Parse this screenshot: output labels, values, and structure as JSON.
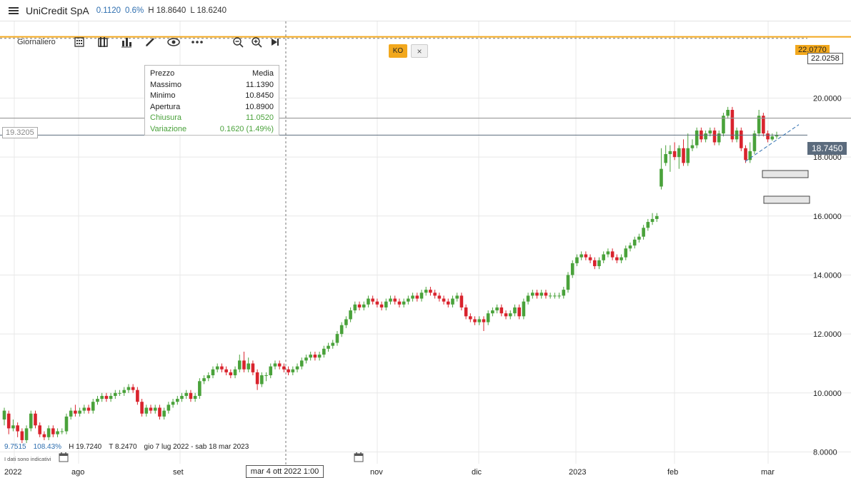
{
  "header": {
    "title": "UniCredit SpA",
    "change_abs": "0.1120",
    "change_pct": "0.6%",
    "high": "H 18.8640",
    "low": "L 18.6240"
  },
  "toolbar": {
    "period": "Giornaliero",
    "icons": [
      "calendar-grid-icon",
      "bar-style-icon",
      "indicators-icon",
      "pencil-icon",
      "eye-icon",
      "more-icon",
      "zoom-out-icon",
      "zoom-in-icon",
      "play-forward-icon"
    ]
  },
  "tooltip": {
    "head_label": "Prezzo",
    "head_value": "Media",
    "rows": [
      {
        "label": "Massimo",
        "value": "11.1390"
      },
      {
        "label": "Minimo",
        "value": "10.8450"
      },
      {
        "label": "Apertura",
        "value": "10.8900"
      },
      {
        "label": "Chiusura",
        "value": "11.0520"
      },
      {
        "label": "Variazione",
        "value": "0.1620 (1.49%)"
      }
    ]
  },
  "ko": {
    "label": "KO",
    "close": "×",
    "price": "22.0770",
    "color": "#f2a81d"
  },
  "crosshair": {
    "price": "22.0258",
    "date": "mar 4 ott 2022 1:00"
  },
  "hline": {
    "price": "19.3205"
  },
  "last_price": {
    "value": "18.7450",
    "color": "#5b6b7d"
  },
  "footer": {
    "first": "9.7515",
    "pct": "108.43%",
    "high": "H 19.7240",
    "low": "T 8.2470",
    "range": "gio 7 lug 2022 - sab 18 mar 2023",
    "disclaimer": "I dati sono indicativi"
  },
  "chart_data": {
    "type": "candlestick",
    "title": "UniCredit SpA",
    "y_ticks": [
      "8.0000",
      "10.0000",
      "12.0000",
      "14.0000",
      "16.0000",
      "18.0000",
      "20.0000"
    ],
    "x_ticks": [
      "2022",
      "ago",
      "set",
      "ott",
      "nov",
      "dic",
      "2023",
      "feb",
      "mar"
    ],
    "ylim": [
      7.6,
      22.6
    ],
    "up_color": "#4aa23b",
    "down_color": "#d9232d",
    "candles": [
      [
        9.1,
        9.4,
        8.9,
        9.5
      ],
      [
        9.3,
        8.8,
        8.6,
        9.4
      ],
      [
        8.8,
        8.9,
        8.7,
        9.1
      ],
      [
        8.9,
        8.7,
        8.5,
        9.0
      ],
      [
        8.7,
        8.4,
        8.3,
        8.8
      ],
      [
        8.4,
        8.8,
        8.3,
        8.9
      ],
      [
        8.8,
        9.3,
        8.7,
        9.4
      ],
      [
        9.3,
        8.9,
        8.8,
        9.4
      ],
      [
        8.9,
        8.6,
        8.5,
        9.0
      ],
      [
        8.6,
        8.5,
        8.4,
        8.7
      ],
      [
        8.5,
        8.8,
        8.4,
        8.9
      ],
      [
        8.8,
        8.6,
        8.5,
        8.9
      ],
      [
        8.6,
        8.7,
        8.5,
        8.8
      ],
      [
        8.7,
        8.7,
        8.6,
        8.8
      ],
      [
        8.7,
        9.2,
        8.6,
        9.3
      ],
      [
        9.2,
        9.4,
        9.1,
        9.5
      ],
      [
        9.4,
        9.3,
        9.2,
        9.6
      ],
      [
        9.3,
        9.4,
        9.2,
        9.5
      ],
      [
        9.4,
        9.5,
        9.3,
        9.6
      ],
      [
        9.5,
        9.4,
        9.3,
        9.6
      ],
      [
        9.4,
        9.7,
        9.3,
        9.8
      ],
      [
        9.7,
        9.8,
        9.6,
        9.9
      ],
      [
        9.8,
        9.9,
        9.7,
        10.0
      ],
      [
        9.9,
        9.8,
        9.7,
        10.0
      ],
      [
        9.8,
        9.9,
        9.7,
        10.0
      ],
      [
        9.9,
        10.0,
        9.8,
        10.1
      ],
      [
        10.0,
        10.0,
        9.9,
        10.1
      ],
      [
        10.0,
        10.1,
        9.9,
        10.2
      ],
      [
        10.1,
        10.2,
        10.0,
        10.3
      ],
      [
        10.2,
        10.1,
        10.0,
        10.3
      ],
      [
        10.1,
        9.7,
        9.6,
        10.2
      ],
      [
        9.7,
        9.3,
        9.2,
        9.8
      ],
      [
        9.3,
        9.5,
        9.2,
        9.6
      ],
      [
        9.5,
        9.4,
        9.3,
        9.6
      ],
      [
        9.4,
        9.5,
        9.3,
        9.6
      ],
      [
        9.5,
        9.2,
        9.1,
        9.6
      ],
      [
        9.2,
        9.4,
        9.1,
        9.5
      ],
      [
        9.4,
        9.6,
        9.3,
        9.7
      ],
      [
        9.6,
        9.7,
        9.5,
        9.8
      ],
      [
        9.7,
        9.8,
        9.6,
        9.9
      ],
      [
        9.8,
        9.9,
        9.7,
        10.0
      ],
      [
        9.9,
        10.0,
        9.8,
        10.1
      ],
      [
        10.0,
        9.8,
        9.7,
        10.1
      ],
      [
        9.8,
        9.9,
        9.7,
        10.0
      ],
      [
        9.9,
        10.4,
        9.8,
        10.5
      ],
      [
        10.4,
        10.5,
        10.3,
        10.6
      ],
      [
        10.5,
        10.6,
        10.4,
        10.7
      ],
      [
        10.6,
        10.8,
        10.5,
        10.9
      ],
      [
        10.8,
        10.9,
        10.7,
        11.0
      ],
      [
        10.9,
        10.8,
        10.7,
        11.0
      ],
      [
        10.8,
        10.7,
        10.6,
        10.9
      ],
      [
        10.7,
        10.6,
        10.5,
        10.8
      ],
      [
        10.6,
        10.8,
        10.5,
        10.9
      ],
      [
        10.8,
        11.1,
        10.7,
        11.3
      ],
      [
        11.1,
        10.8,
        10.7,
        11.4
      ],
      [
        10.8,
        11.0,
        10.7,
        11.2
      ],
      [
        11.0,
        10.7,
        10.6,
        11.1
      ],
      [
        10.7,
        10.3,
        10.1,
        10.8
      ],
      [
        10.3,
        10.6,
        10.2,
        10.7
      ],
      [
        10.6,
        10.6,
        10.4,
        10.7
      ],
      [
        10.6,
        10.9,
        10.5,
        11.0
      ],
      [
        10.9,
        11.0,
        10.8,
        11.1
      ],
      [
        11.0,
        10.9,
        10.8,
        11.1
      ],
      [
        10.9,
        10.8,
        10.7,
        11.0
      ],
      [
        10.8,
        10.7,
        10.6,
        10.9
      ],
      [
        10.7,
        10.8,
        10.6,
        10.9
      ],
      [
        10.8,
        10.9,
        10.7,
        11.0
      ],
      [
        10.9,
        11.1,
        10.8,
        11.2
      ],
      [
        11.1,
        11.2,
        11.0,
        11.3
      ],
      [
        11.2,
        11.3,
        11.1,
        11.4
      ],
      [
        11.3,
        11.2,
        11.1,
        11.4
      ],
      [
        11.2,
        11.3,
        11.1,
        11.4
      ],
      [
        11.3,
        11.5,
        11.2,
        11.6
      ],
      [
        11.5,
        11.6,
        11.4,
        11.7
      ],
      [
        11.6,
        11.7,
        11.5,
        11.8
      ],
      [
        11.7,
        12.0,
        11.6,
        12.1
      ],
      [
        12.0,
        12.3,
        11.9,
        12.4
      ],
      [
        12.3,
        12.5,
        12.2,
        12.6
      ],
      [
        12.5,
        12.8,
        12.4,
        12.9
      ],
      [
        12.8,
        13.0,
        12.7,
        13.1
      ],
      [
        13.0,
        12.9,
        12.8,
        13.1
      ],
      [
        12.9,
        13.0,
        12.8,
        13.1
      ],
      [
        13.0,
        13.2,
        12.9,
        13.3
      ],
      [
        13.2,
        13.1,
        13.0,
        13.3
      ],
      [
        13.1,
        13.0,
        12.9,
        13.2
      ],
      [
        13.0,
        12.9,
        12.8,
        13.1
      ],
      [
        12.9,
        13.1,
        12.8,
        13.2
      ],
      [
        13.1,
        13.2,
        13.0,
        13.3
      ],
      [
        13.2,
        13.1,
        13.0,
        13.3
      ],
      [
        13.1,
        13.0,
        12.9,
        13.2
      ],
      [
        13.0,
        13.1,
        12.9,
        13.2
      ],
      [
        13.1,
        13.2,
        13.0,
        13.3
      ],
      [
        13.2,
        13.3,
        13.1,
        13.4
      ],
      [
        13.3,
        13.2,
        13.1,
        13.4
      ],
      [
        13.2,
        13.4,
        13.1,
        13.5
      ],
      [
        13.4,
        13.5,
        13.3,
        13.6
      ],
      [
        13.5,
        13.4,
        13.3,
        13.6
      ],
      [
        13.4,
        13.3,
        13.2,
        13.5
      ],
      [
        13.3,
        13.2,
        13.1,
        13.4
      ],
      [
        13.2,
        13.1,
        13.0,
        13.3
      ],
      [
        13.1,
        13.0,
        12.9,
        13.2
      ],
      [
        13.0,
        13.2,
        12.9,
        13.3
      ],
      [
        13.2,
        13.3,
        13.1,
        13.4
      ],
      [
        13.3,
        12.9,
        12.8,
        13.4
      ],
      [
        12.9,
        12.6,
        12.5,
        13.0
      ],
      [
        12.6,
        12.5,
        12.4,
        12.7
      ],
      [
        12.5,
        12.4,
        12.3,
        12.6
      ],
      [
        12.4,
        12.5,
        12.3,
        12.6
      ],
      [
        12.5,
        12.4,
        12.1,
        12.6
      ],
      [
        12.4,
        12.7,
        12.3,
        12.8
      ],
      [
        12.7,
        12.8,
        12.6,
        12.9
      ],
      [
        12.8,
        12.9,
        12.7,
        13.0
      ],
      [
        12.9,
        12.7,
        12.6,
        13.0
      ],
      [
        12.7,
        12.6,
        12.5,
        12.8
      ],
      [
        12.6,
        12.7,
        12.5,
        12.8
      ],
      [
        12.7,
        12.9,
        12.6,
        13.0
      ],
      [
        12.9,
        12.6,
        12.5,
        13.0
      ],
      [
        12.6,
        13.1,
        12.5,
        13.2
      ],
      [
        13.1,
        13.3,
        13.0,
        13.4
      ],
      [
        13.3,
        13.4,
        13.2,
        13.5
      ],
      [
        13.4,
        13.3,
        13.2,
        13.5
      ],
      [
        13.3,
        13.4,
        13.2,
        13.5
      ],
      [
        13.4,
        13.3,
        13.2,
        13.5
      ],
      [
        13.3,
        13.3,
        13.2,
        13.4
      ],
      [
        13.3,
        13.3,
        13.2,
        13.4
      ],
      [
        13.3,
        13.3,
        13.2,
        13.4
      ],
      [
        13.3,
        13.5,
        13.2,
        13.6
      ],
      [
        13.5,
        14.0,
        13.4,
        14.1
      ],
      [
        14.0,
        14.4,
        13.9,
        14.5
      ],
      [
        14.4,
        14.6,
        14.3,
        14.7
      ],
      [
        14.6,
        14.7,
        14.5,
        14.8
      ],
      [
        14.7,
        14.6,
        14.5,
        14.8
      ],
      [
        14.6,
        14.5,
        14.4,
        14.7
      ],
      [
        14.5,
        14.3,
        14.2,
        14.6
      ],
      [
        14.3,
        14.5,
        14.2,
        14.6
      ],
      [
        14.5,
        14.7,
        14.4,
        14.8
      ],
      [
        14.7,
        14.8,
        14.6,
        14.9
      ],
      [
        14.8,
        14.6,
        14.5,
        14.9
      ],
      [
        14.6,
        14.5,
        14.4,
        14.7
      ],
      [
        14.5,
        14.6,
        14.4,
        14.7
      ],
      [
        14.6,
        14.9,
        14.5,
        15.0
      ],
      [
        14.9,
        15.0,
        14.8,
        15.1
      ],
      [
        15.0,
        15.2,
        14.9,
        15.3
      ],
      [
        15.2,
        15.3,
        15.1,
        15.4
      ],
      [
        15.3,
        15.6,
        15.2,
        15.7
      ],
      [
        15.6,
        15.8,
        15.5,
        15.9
      ],
      [
        15.8,
        15.9,
        15.7,
        16.1
      ],
      [
        15.9,
        16.0,
        15.8,
        16.1
      ],
      [
        17.0,
        17.6,
        16.9,
        18.3
      ],
      [
        17.8,
        18.1,
        17.7,
        18.4
      ],
      [
        18.1,
        18.2,
        17.5,
        18.4
      ],
      [
        18.2,
        18.0,
        17.9,
        18.5
      ],
      [
        18.0,
        18.3,
        17.6,
        18.4
      ],
      [
        18.3,
        17.8,
        17.7,
        18.6
      ],
      [
        17.8,
        18.3,
        17.7,
        18.8
      ],
      [
        18.3,
        18.4,
        18.2,
        18.6
      ],
      [
        18.4,
        18.9,
        18.3,
        19.0
      ],
      [
        18.9,
        18.6,
        18.5,
        19.0
      ],
      [
        18.6,
        18.8,
        18.5,
        18.9
      ],
      [
        18.8,
        18.9,
        18.7,
        19.0
      ],
      [
        18.9,
        18.5,
        18.4,
        19.0
      ],
      [
        18.5,
        18.8,
        18.4,
        18.9
      ],
      [
        18.8,
        19.4,
        18.7,
        19.5
      ],
      [
        19.4,
        19.6,
        19.3,
        19.7
      ],
      [
        19.6,
        18.6,
        18.5,
        19.7
      ],
      [
        18.6,
        18.9,
        18.5,
        19.0
      ],
      [
        18.9,
        18.3,
        18.2,
        19.0
      ],
      [
        18.3,
        17.9,
        17.8,
        18.4
      ],
      [
        17.9,
        18.2,
        17.8,
        18.5
      ],
      [
        18.2,
        18.8,
        18.1,
        18.9
      ],
      [
        18.8,
        19.4,
        18.7,
        19.6
      ],
      [
        19.4,
        18.8,
        18.7,
        19.5
      ],
      [
        18.8,
        18.6,
        18.5,
        18.9
      ],
      [
        18.6,
        18.7,
        18.55,
        18.8
      ],
      [
        18.7,
        18.75,
        18.62,
        18.86
      ]
    ]
  }
}
